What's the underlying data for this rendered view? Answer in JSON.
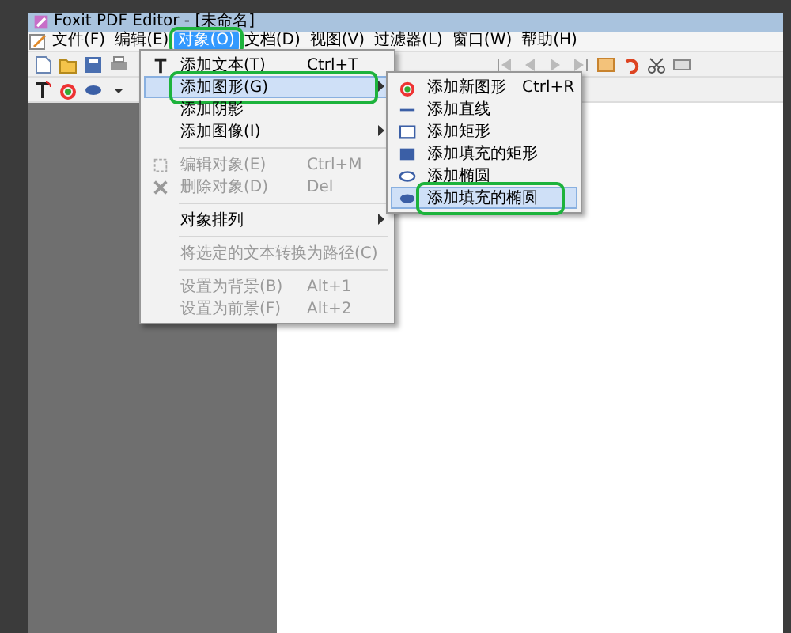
{
  "window": {
    "title": "Foxit PDF Editor - [未命名]"
  },
  "menu_bar": [
    {
      "label": "文件(F)",
      "selected": false,
      "highlighted": false
    },
    {
      "label": "编辑(E)",
      "selected": false,
      "highlighted": false
    },
    {
      "label": "对象(O)",
      "selected": true,
      "highlighted": true
    },
    {
      "label": "文档(D)",
      "selected": false,
      "highlighted": false
    },
    {
      "label": "视图(V)",
      "selected": false,
      "highlighted": false
    },
    {
      "label": "过滤器(L)",
      "selected": false,
      "highlighted": false
    },
    {
      "label": "窗口(W)",
      "selected": false,
      "highlighted": false
    },
    {
      "label": "帮助(H)",
      "selected": false,
      "highlighted": false
    }
  ],
  "object_menu": {
    "items": [
      {
        "kind": "item",
        "label": "添加文本(T)",
        "shortcut": "Ctrl+T",
        "selected": false,
        "disabled": false,
        "submenu": false,
        "highlighted": false
      },
      {
        "kind": "item",
        "label": "添加图形(G)",
        "selected": true,
        "disabled": false,
        "submenu": true,
        "highlighted": true
      },
      {
        "kind": "item",
        "label": "添加阴影",
        "selected": false,
        "disabled": false,
        "submenu": false,
        "highlighted": false
      },
      {
        "kind": "item",
        "label": "添加图像(I)",
        "selected": false,
        "disabled": false,
        "submenu": true,
        "highlighted": false
      },
      {
        "kind": "separator"
      },
      {
        "kind": "item",
        "label": "编辑对象(E)",
        "shortcut": "Ctrl+M",
        "selected": false,
        "disabled": true,
        "submenu": false,
        "highlighted": false
      },
      {
        "kind": "item",
        "label": "删除对象(D)",
        "shortcut": "Del",
        "selected": false,
        "disabled": true,
        "submenu": false,
        "highlighted": false
      },
      {
        "kind": "separator"
      },
      {
        "kind": "item",
        "label": "对象排列",
        "selected": false,
        "disabled": false,
        "submenu": true,
        "highlighted": false
      },
      {
        "kind": "separator"
      },
      {
        "kind": "item",
        "label": "将选定的文本转换为路径(C)",
        "selected": false,
        "disabled": true,
        "submenu": false,
        "highlighted": false
      },
      {
        "kind": "separator"
      },
      {
        "kind": "item",
        "label": "设置为背景(B)",
        "shortcut": "Alt+1",
        "selected": false,
        "disabled": true,
        "submenu": false,
        "highlighted": false
      },
      {
        "kind": "item",
        "label": "设置为前景(F)",
        "shortcut": "Alt+2",
        "selected": false,
        "disabled": true,
        "submenu": false,
        "highlighted": false
      }
    ]
  },
  "shape_submenu": {
    "items": [
      {
        "label": "添加新图形",
        "shortcut": "Ctrl+R",
        "selected": false,
        "highlighted": false
      },
      {
        "label": "添加直线",
        "selected": false,
        "highlighted": false
      },
      {
        "label": "添加矩形",
        "selected": false,
        "highlighted": false
      },
      {
        "label": "添加填充的矩形",
        "selected": false,
        "highlighted": false
      },
      {
        "label": "添加椭圆",
        "selected": false,
        "highlighted": false
      },
      {
        "label": "添加填充的椭圆",
        "selected": true,
        "highlighted": true
      }
    ]
  }
}
